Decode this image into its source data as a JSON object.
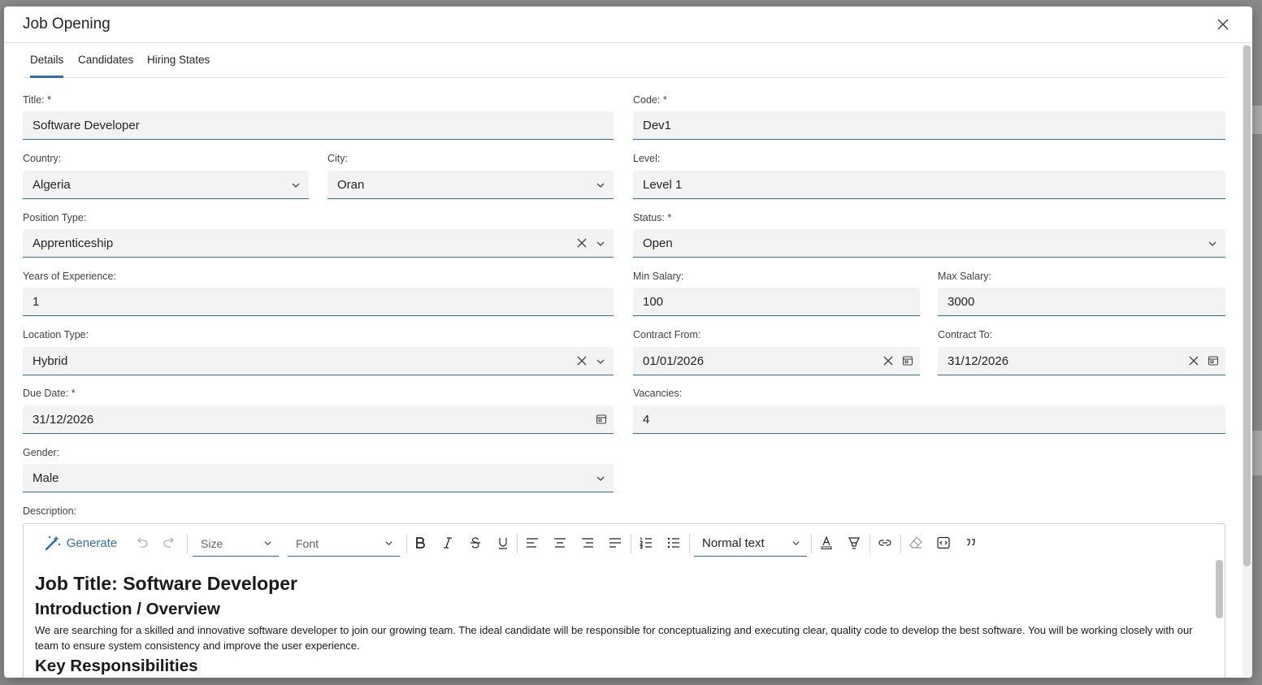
{
  "dialog": {
    "title": "Job Opening"
  },
  "tabs": [
    {
      "label": "Details",
      "active": true
    },
    {
      "label": "Candidates",
      "active": false
    },
    {
      "label": "Hiring States",
      "active": false
    }
  ],
  "form": {
    "title": {
      "label": "Title: *",
      "value": "Software Developer"
    },
    "code": {
      "label": "Code: *",
      "value": "Dev1"
    },
    "country": {
      "label": "Country:",
      "value": "Algeria"
    },
    "city": {
      "label": "City:",
      "value": "Oran"
    },
    "level": {
      "label": "Level:",
      "value": "Level 1"
    },
    "position_type": {
      "label": "Position Type:",
      "value": "Apprenticeship"
    },
    "status": {
      "label": "Status: *",
      "value": "Open"
    },
    "years_experience": {
      "label": "Years of Experience:",
      "value": "1"
    },
    "min_salary": {
      "label": "Min Salary:",
      "value": "100"
    },
    "max_salary": {
      "label": "Max Salary:",
      "value": "3000"
    },
    "location_type": {
      "label": "Location Type:",
      "value": "Hybrid"
    },
    "contract_from": {
      "label": "Contract From:",
      "value": "01/01/2026"
    },
    "contract_to": {
      "label": "Contract To:",
      "value": "31/12/2026"
    },
    "due_date": {
      "label": "Due Date: *",
      "value": "31/12/2026"
    },
    "vacancies": {
      "label": "Vacancies:",
      "value": "4"
    },
    "gender": {
      "label": "Gender:",
      "value": "Male"
    },
    "description_label": "Description:"
  },
  "editor": {
    "toolbar": {
      "generate_label": "Generate",
      "size_placeholder": "Size",
      "font_placeholder": "Font",
      "block_format": "Normal text"
    },
    "content": {
      "h1": "Job Title: Software Developer",
      "h2_intro": "Introduction / Overview",
      "intro_text": "We are searching for a skilled and innovative software developer to join our growing team. The ideal candidate will be responsible for conceptualizing and executing clear, quality code to develop the best software. You will be working closely with our team to ensure system consistency and improve the user experience.",
      "h2_resp": "Key Responsibilities"
    }
  },
  "colors": {
    "accent": "#2a6fb5",
    "field_bg": "#f3f3f3"
  }
}
